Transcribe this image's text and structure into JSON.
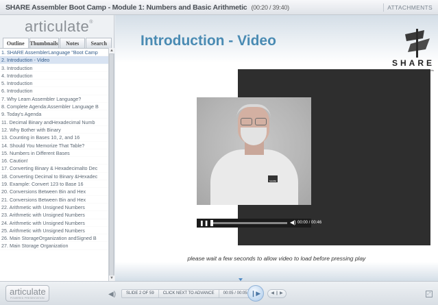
{
  "window": {
    "title": "SHARE Assembler Boot Camp - Module 1: Numbers and Basic Arithmetic",
    "timecode": "(00:20 / 39:40)",
    "attachments_label": "ATTACHMENTS"
  },
  "sidebar": {
    "logo": "articulate",
    "tabs": [
      "Outline",
      "Thumbnails",
      "Notes",
      "Search"
    ],
    "active_tab": "Outline",
    "items": [
      "1. SHARE AssemblerLanguage \"Boot Camp",
      "2. Introduction - Video",
      "3. Introduction",
      "4. Introduction",
      "5. Introduction",
      "6. Introduction",
      "7. Why Learn Assembler Language?",
      "8. Complete Agenda:Assembler Language B",
      "9. Today's Agenda",
      "11. Decimal  Binary andHexadecimal Numb",
      "12. Why Bother with Binary",
      "13. Counting in Bases 10, 2, and 16",
      "14. Should You Memorize That Table?",
      "15. Numbers in Different Bases",
      "16. Caution!",
      "17. Converting Binary & Hexadecimalto Dec",
      "18. Converting Decimal to Binary &Hexadec",
      "19. Example: Convert 123   to Base 16",
      "20. Conversions Between Bin and Hex",
      "21. Conversions Between Bin and Hex",
      "22. Arithmetic with Unsigned Numbers",
      "23. Arithmetic with Unsigned Numbers",
      "24. Arithmetic with Unsigned Numbers",
      "25. Arithmetic with Unsigned Numbers",
      "26. Main StorageOrganization andSigned B",
      "27. Main Storage Organization"
    ],
    "current_index": 1
  },
  "slide": {
    "title": "Introduction - Video",
    "brand_word": "SHARE",
    "brand_tagline": "Technology • Connections • Results",
    "shirt_logo": "SHARE",
    "video_time": "00:00 / 00:46",
    "caption": "please wait a few seconds to allow video to load before pressing play"
  },
  "bottombar": {
    "logo_main": "articulate",
    "logo_sub": "POWERED PRESENTATION",
    "slide_counter": "SLIDE 2 OF 59",
    "advance_hint": "CLICK NEXT TO ADVANCE",
    "slide_time": "00:05 / 00:05"
  },
  "colors": {
    "title_blue": "#4a8bb3",
    "current_item_bg": "#d8e3f2",
    "video_frame": "#2e2e2e"
  }
}
